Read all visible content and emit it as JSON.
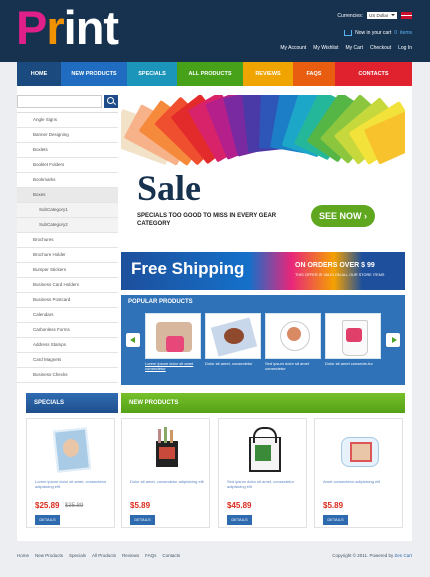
{
  "logo": {
    "letters": [
      "P",
      "r",
      "int"
    ]
  },
  "header": {
    "currencies_label": "Currencies:",
    "currency_value": "US Dollar",
    "cart_text": "Now in your cart",
    "cart_count": "0",
    "cart_items": "items",
    "account_links": [
      "My Account",
      "My Wishlist",
      "My Cart",
      "Checkout",
      "Log In"
    ]
  },
  "nav": [
    {
      "label": "HOME",
      "color": "#1a4a7e"
    },
    {
      "label": "NEW PRODUCTS",
      "color": "#1f6cc0"
    },
    {
      "label": "SPECIALS",
      "color": "#1b95b9"
    },
    {
      "label": "ALL PRODUCTS",
      "color": "#47a21a"
    },
    {
      "label": "REVIEWS",
      "color": "#f0a400"
    },
    {
      "label": "FAQS",
      "color": "#e85d10"
    },
    {
      "label": "CONTACTS",
      "color": "#e0222f"
    }
  ],
  "sidebar": {
    "categories": [
      {
        "label": "Angle Signs",
        "type": "cat"
      },
      {
        "label": "Banner Designing",
        "type": "cat"
      },
      {
        "label": "Boxlets",
        "type": "cat"
      },
      {
        "label": "Booklet Folders",
        "type": "cat"
      },
      {
        "label": "Bookmarks",
        "type": "cat"
      },
      {
        "label": "Boxes",
        "type": "active"
      },
      {
        "label": "SubCategory1",
        "type": "sub"
      },
      {
        "label": "SubCategory2",
        "type": "sub"
      },
      {
        "label": "Brochures",
        "type": "cat"
      },
      {
        "label": "Brochure Holder",
        "type": "cat"
      },
      {
        "label": "Bumper Stickers",
        "type": "cat"
      },
      {
        "label": "Business Card Holders",
        "type": "cat"
      },
      {
        "label": "Business Postcard",
        "type": "cat"
      },
      {
        "label": "Calendars",
        "type": "cat"
      },
      {
        "label": "Carbonless Forms",
        "type": "cat"
      },
      {
        "label": "Address Stamps",
        "type": "cat"
      },
      {
        "label": "Card Magnets",
        "type": "cat"
      },
      {
        "label": "Business Checks",
        "type": "cat"
      }
    ]
  },
  "sale_banner": {
    "title": "Sale",
    "subtitle": "SPECIALS TOO GOOD TO MISS IN EVERY GEAR CATEGORY",
    "button": "SEE NOW ›"
  },
  "free_shipping": {
    "title": "Free Shipping",
    "side": "ON ORDERS OVER $ 99",
    "tiny": "THIS OFFER IS VALID ON ALL OUR STORE ITEMS"
  },
  "popular": {
    "heading": "POPULAR PRODUCTS",
    "items": [
      {
        "caption": "Lorem ipsum dolor sit amet consectetur"
      },
      {
        "caption": "Dolor sit amet, consectetur"
      },
      {
        "caption": "Sed ipsum dolor sit amet consectetur"
      },
      {
        "caption": "Dolor sit amet consecte-tur"
      }
    ]
  },
  "specials_heading": "SPECIALS",
  "new_products_heading": "NEW PRODUCTS",
  "products": [
    {
      "desc": "Lorem ipsum dolor sit amet, consectetur adipisicing elit",
      "price": "$25.89",
      "old_price": "$35.89",
      "button": "DETAILS"
    },
    {
      "desc": "Dolor sit amet, consectetur adipisicing elit",
      "price": "$5.89",
      "old_price": "",
      "button": "DETAILS"
    },
    {
      "desc": "Sed ipsum dolor sit amet, consectetur adipisicing elit",
      "price": "$45.89",
      "old_price": "",
      "button": "DETAILS"
    },
    {
      "desc": "Amet consectetur adipisicing elit",
      "price": "$5.89",
      "old_price": "",
      "button": "DETAILS"
    }
  ],
  "footer": {
    "links": [
      "Home",
      "New Products",
      "Specials",
      "All Products",
      "Reviews",
      "FAQs",
      "Contacts"
    ],
    "copyright": "Copyright © 2011. Powered by ",
    "copyright_link": "Zen Cart"
  }
}
